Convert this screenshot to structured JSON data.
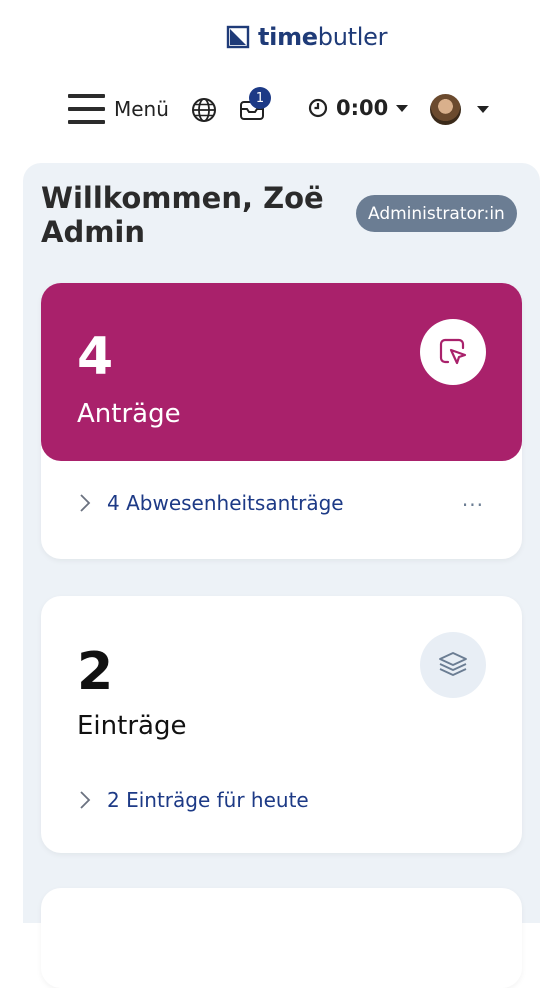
{
  "header": {
    "logo_bold": "time",
    "logo_light": "butler",
    "menu_label": "Menü",
    "inbox_badge": "1",
    "timer_value": "0:00"
  },
  "panel": {
    "welcome": "Willkommen, Zoë Admin",
    "role": "Administrator:in"
  },
  "cards": [
    {
      "number": "4",
      "label": "Anträge",
      "link": "4 Abwesenheitsanträge",
      "more": "···",
      "color": "#a9216b",
      "icon": "sticky-note-cursor-icon"
    },
    {
      "number": "2",
      "label": "Einträge",
      "link": "2 Einträge für heute",
      "icon": "layers-icon"
    }
  ]
}
